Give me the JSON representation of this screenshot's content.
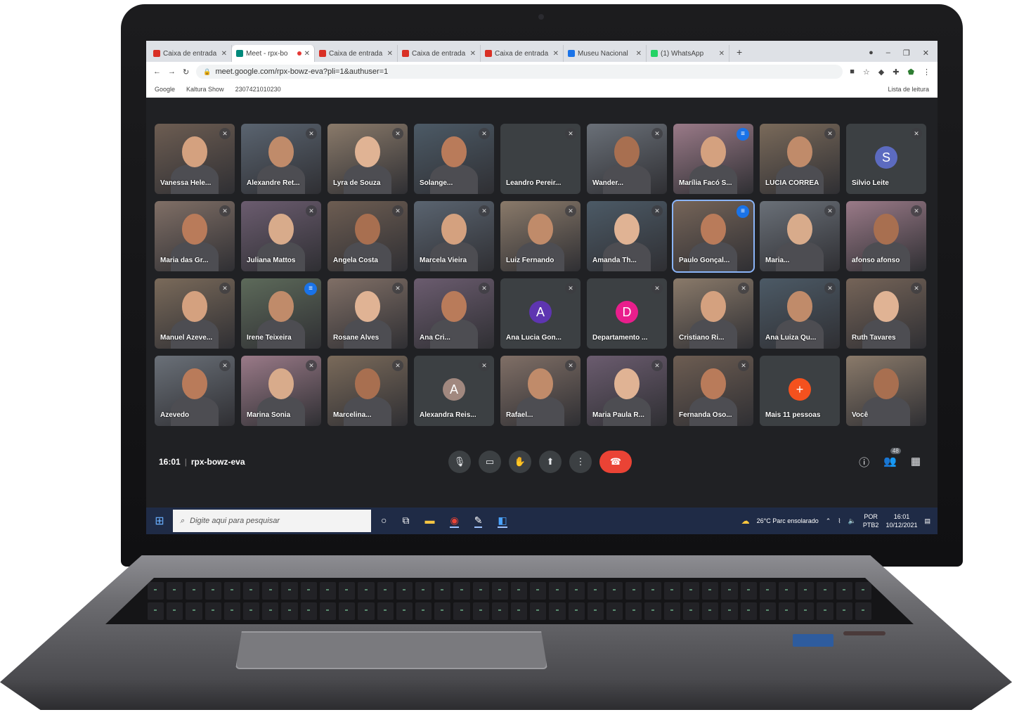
{
  "browser": {
    "tabs": [
      {
        "title": "Caixa de entrada",
        "favicon": "gmail-icon",
        "active": false
      },
      {
        "title": "Meet - rpx-bo",
        "favicon": "meet-icon",
        "active": true,
        "recording": true
      },
      {
        "title": "Caixa de entrada",
        "favicon": "gmail-icon",
        "active": false
      },
      {
        "title": "Caixa de entrada",
        "favicon": "gmail-icon",
        "active": false
      },
      {
        "title": "Caixa de entrada",
        "favicon": "gmail-icon",
        "active": false
      },
      {
        "title": "Museu Nacional",
        "favicon": "page-icon",
        "active": false
      },
      {
        "title": "(1) WhatsApp",
        "favicon": "whatsapp-icon",
        "active": false
      }
    ],
    "new_tab": "+",
    "url": "meet.google.com/rpx-bowz-eva?pli=1&authuser=1",
    "bookmarks": [
      "Google",
      "Kaltura Show",
      "2307421010230"
    ],
    "reading_list": "Lista de leitura"
  },
  "meeting": {
    "time": "16:01",
    "code": "rpx-bowz-eva",
    "participants": [
      {
        "name": "Vanessa Hele...",
        "mic": "muted"
      },
      {
        "name": "Alexandre Ret...",
        "mic": "muted"
      },
      {
        "name": "Lyra de Souza",
        "mic": "muted"
      },
      {
        "name": "Solange...",
        "mic": "muted"
      },
      {
        "name": "Leandro Pereir...",
        "mic": "muted",
        "avatar": true
      },
      {
        "name": "Wander...",
        "mic": "muted"
      },
      {
        "name": "Marília Facó S...",
        "mic": "speaking"
      },
      {
        "name": "LUCIA CORREA",
        "mic": "muted"
      },
      {
        "name": "Silvio Leite",
        "mic": "muted",
        "avatar": true,
        "initial": "S",
        "avatar_color": "#5c6bc0"
      },
      {
        "name": "Maria das Gr...",
        "mic": "muted"
      },
      {
        "name": "Juliana Mattos",
        "mic": "muted"
      },
      {
        "name": "Angela Costa",
        "mic": "muted"
      },
      {
        "name": "Marcela Vieira",
        "mic": "muted"
      },
      {
        "name": "Luiz Fernando",
        "mic": "muted"
      },
      {
        "name": "Amanda Th...",
        "mic": "muted"
      },
      {
        "name": "Paulo Gonçal...",
        "mic": "speaking",
        "highlight": true
      },
      {
        "name": "Maria...",
        "mic": "muted"
      },
      {
        "name": "afonso afonso",
        "mic": "muted"
      },
      {
        "name": "Manuel Azeve...",
        "mic": "muted"
      },
      {
        "name": "Irene Teixeira",
        "mic": "speaking"
      },
      {
        "name": "Rosane Alves",
        "mic": "muted"
      },
      {
        "name": "Ana Cri...",
        "mic": "muted"
      },
      {
        "name": "Ana Lucia Gon...",
        "mic": "muted",
        "avatar": true,
        "initial": "A",
        "avatar_color": "#5e35b1"
      },
      {
        "name": "Departamento ...",
        "mic": "muted",
        "avatar": true,
        "initial": "D",
        "avatar_color": "#e91e8c"
      },
      {
        "name": "Cristiano Ri...",
        "mic": "muted"
      },
      {
        "name": "Ana Luiza Qu...",
        "mic": "muted"
      },
      {
        "name": "Ruth Tavares",
        "mic": "muted"
      },
      {
        "name": "Azevedo",
        "mic": "muted"
      },
      {
        "name": "Marina Sonia",
        "mic": "muted"
      },
      {
        "name": "Marcelina...",
        "mic": "muted"
      },
      {
        "name": "Alexandra Reis...",
        "mic": "muted",
        "avatar": true,
        "initial": "A",
        "avatar_color": "#a1887f"
      },
      {
        "name": "Rafael...",
        "mic": "muted"
      },
      {
        "name": "Maria Paula R...",
        "mic": "muted"
      },
      {
        "name": "Fernanda Oso...",
        "mic": "muted"
      },
      {
        "name": "Mais 11 pessoas",
        "mic": "none",
        "avatar": true,
        "initial": "+",
        "avatar_color": "#f4511e"
      },
      {
        "name": "Você",
        "mic": "none"
      }
    ],
    "controls": [
      "mic-icon",
      "camera-icon",
      "raise-hand-icon",
      "present-icon",
      "more-icon",
      "end-call-icon"
    ],
    "right_controls": [
      "info-icon",
      "people-icon",
      "chat-icon"
    ],
    "people_count": "48"
  },
  "taskbar": {
    "search_placeholder": "Digite aqui para pesquisar",
    "weather": "26°C Parc ensolarado",
    "lang": "POR",
    "lang2": "PTB2",
    "time": "16:01",
    "date": "10/12/2021"
  },
  "colors": {
    "meet_bg": "#202124",
    "tile_bg": "#3c4043",
    "end_call": "#ea4335",
    "speaking": "#1a73e8",
    "taskbar": "#1f2b46"
  }
}
